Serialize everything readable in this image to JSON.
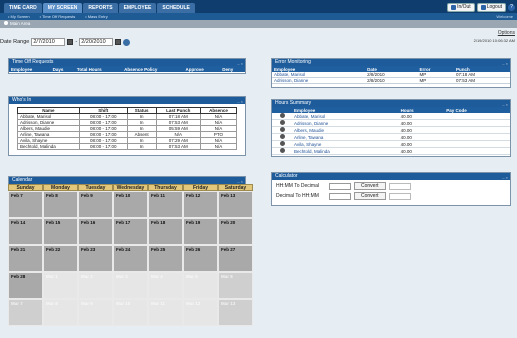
{
  "nav": {
    "tabs": [
      {
        "label": "TIME CARD"
      },
      {
        "label": "MY SCREEN"
      },
      {
        "label": "REPORTS"
      },
      {
        "label": "EMPLOYEE"
      },
      {
        "label": "SCHEDULE"
      }
    ],
    "subnav": [
      "• My Screen",
      "• Time Off Requests",
      "• Mass Entry"
    ],
    "subnav_right": "Welcome",
    "inout_label": "In/Out",
    "logout_label": "Logout",
    "help_label": "?"
  },
  "crumb": "Main Area",
  "options_label": "Options",
  "date_range": {
    "label": "Date Range",
    "start": "2/7/2010",
    "end": "2/20/2010"
  },
  "date_right": "2/19/2010 10:06:32 AM",
  "time_off": {
    "title": "Time Off Requests",
    "columns": [
      "Employee",
      "Days",
      "Total Hours",
      "Absence Policy",
      "Approve",
      "Deny"
    ]
  },
  "error_monitoring": {
    "title": "Error Monitoring",
    "columns": [
      "Employee",
      "Date",
      "Error",
      "Punch"
    ],
    "rows": [
      {
        "employee": "Abbate, Marisol",
        "date": "2/8/2010",
        "error": "MP",
        "punch": "07:18 AM"
      },
      {
        "employee": "Adrisson, Dianne",
        "date": "2/8/2010",
        "error": "MP",
        "punch": "07:53 AM"
      }
    ]
  },
  "whos_in": {
    "title": "Who's In",
    "columns": [
      "Name",
      "Shift",
      "Status",
      "Last Punch",
      "Absence"
    ],
    "rows": [
      {
        "name": "Abbate, Marisol",
        "shift": "08:00 - 17:00",
        "status": "In",
        "punch": "07:18 AM",
        "absence": "N/A"
      },
      {
        "name": "Adrisson, Dianne",
        "shift": "08:00 - 17:00",
        "status": "In",
        "punch": "07:53 AM",
        "absence": "N/A"
      },
      {
        "name": "Albers, Maudie",
        "shift": "08:00 - 17:00",
        "status": "In",
        "punch": "05:59 AM",
        "absence": "N/A"
      },
      {
        "name": "Arline, Tawana",
        "shift": "08:00 - 17:00",
        "status": "Absent",
        "punch": "N/A",
        "absence": "PTO"
      },
      {
        "name": "Avila, Shayne",
        "shift": "08:00 - 17:00",
        "status": "In",
        "punch": "07:29 AM",
        "absence": "N/A"
      },
      {
        "name": "Bechtold, Malinda",
        "shift": "08:00 - 17:00",
        "status": "In",
        "punch": "07:53 AM",
        "absence": "N/A"
      }
    ]
  },
  "hours_summary": {
    "title": "Hours Summary",
    "columns": [
      "",
      "Employee",
      "Hours",
      "Pay Code"
    ],
    "rows": [
      {
        "employee": "Abbate, Marisol",
        "hours": "40.00"
      },
      {
        "employee": "Adrisson, Dianne",
        "hours": "40.00"
      },
      {
        "employee": "Albers, Maudie",
        "hours": "40.00"
      },
      {
        "employee": "Arline, Tawana",
        "hours": "40.00"
      },
      {
        "employee": "Avila, Shayne",
        "hours": "40.00"
      },
      {
        "employee": "Bechtold, Malinda",
        "hours": "40.00"
      }
    ]
  },
  "calendar": {
    "title": "Calendar",
    "days": [
      "Sunday",
      "Monday",
      "Tuesday",
      "Wednesday",
      "Thursday",
      "Friday",
      "Saturday"
    ],
    "cells": [
      "Feb 7",
      "Feb 8",
      "Feb 9",
      "Feb 10",
      "Feb 11",
      "Feb 12",
      "Feb 13",
      "Feb 14",
      "Feb 15",
      "Feb 16",
      "Feb 17",
      "Feb 18",
      "Feb 19",
      "Feb 20",
      "Feb 21",
      "Feb 22",
      "Feb 23",
      "Feb 24",
      "Feb 25",
      "Feb 26",
      "Feb 27",
      "Feb 28",
      "Mar 1",
      "Mar 2",
      "Mar 3",
      "Mar 4",
      "Mar 5",
      "Mar 6",
      "Mar 7",
      "Mar 8",
      "Mar 9",
      "Mar 10",
      "Mar 11",
      "Mar 12",
      "Mar 13"
    ]
  },
  "calculator": {
    "title": "Calculator",
    "row1_label": "HH:MM To Decimal",
    "row2_label": "Decimal To HH:MM",
    "convert_label": "Convert"
  }
}
